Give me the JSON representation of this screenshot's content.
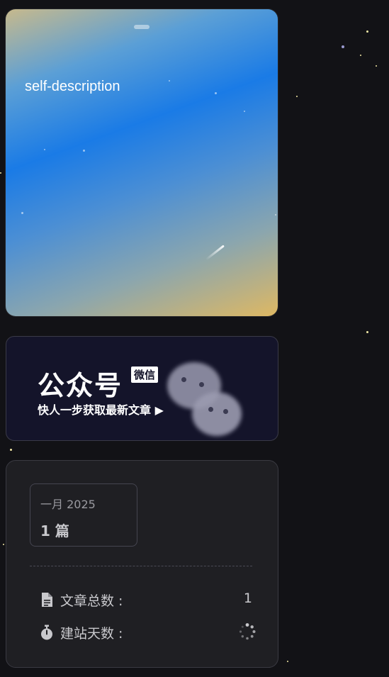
{
  "profile_card": {
    "description": "self-description"
  },
  "wechat_card": {
    "title": "公众号",
    "badge": "微信",
    "subtitle": "快人一步获取最新文章 ▶"
  },
  "archive": {
    "month": "一月 2025",
    "count": "1 篇"
  },
  "stats": {
    "articles_label": "文章总数 :",
    "articles_value": "1",
    "days_label": "建站天数 :"
  },
  "icons": {
    "articles": "file-icon",
    "days": "stopwatch-icon",
    "loading": "loading-spinner-icon"
  }
}
